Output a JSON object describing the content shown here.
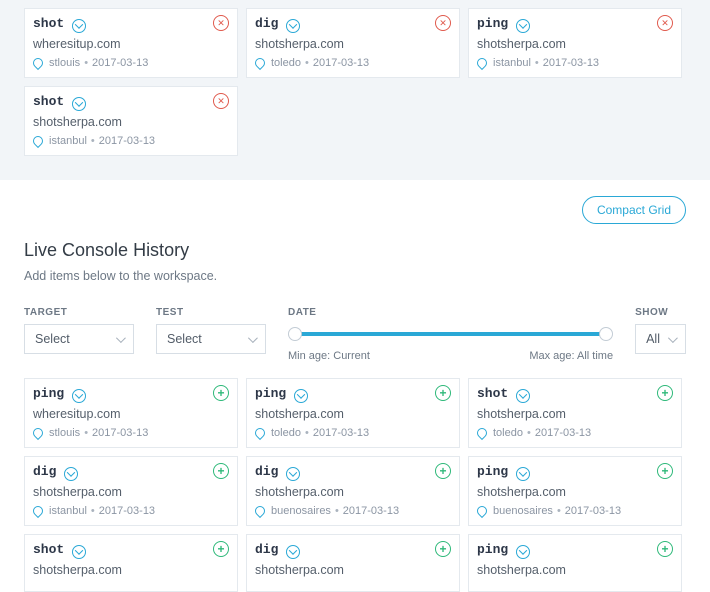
{
  "workspace": {
    "cards": [
      {
        "cmd": "shot",
        "domain": "wheresitup.com",
        "location": "stlouis",
        "date": "2017-03-13"
      },
      {
        "cmd": "dig",
        "domain": "shotsherpa.com",
        "location": "toledo",
        "date": "2017-03-13"
      },
      {
        "cmd": "ping",
        "domain": "shotsherpa.com",
        "location": "istanbul",
        "date": "2017-03-13"
      },
      {
        "cmd": "shot",
        "domain": "shotsherpa.com",
        "location": "istanbul",
        "date": "2017-03-13"
      }
    ]
  },
  "compact_grid_label": "Compact Grid",
  "history_section": {
    "title": "Live Console History",
    "subtitle": "Add items below to the workspace."
  },
  "filters": {
    "target": {
      "label": "TARGET",
      "value": "Select"
    },
    "test": {
      "label": "TEST",
      "value": "Select"
    },
    "date": {
      "label": "DATE",
      "min_label": "Min age: Current",
      "max_label": "Max age: All time"
    },
    "show": {
      "label": "SHOW",
      "value": "All"
    }
  },
  "history": {
    "cards": [
      {
        "cmd": "ping",
        "domain": "wheresitup.com",
        "location": "stlouis",
        "date": "2017-03-13"
      },
      {
        "cmd": "ping",
        "domain": "shotsherpa.com",
        "location": "toledo",
        "date": "2017-03-13"
      },
      {
        "cmd": "shot",
        "domain": "shotsherpa.com",
        "location": "toledo",
        "date": "2017-03-13"
      },
      {
        "cmd": "dig",
        "domain": "shotsherpa.com",
        "location": "istanbul",
        "date": "2017-03-13"
      },
      {
        "cmd": "dig",
        "domain": "shotsherpa.com",
        "location": "buenosaires",
        "date": "2017-03-13"
      },
      {
        "cmd": "ping",
        "domain": "shotsherpa.com",
        "location": "buenosaires",
        "date": "2017-03-13"
      },
      {
        "cmd": "shot",
        "domain": "shotsherpa.com",
        "location": "",
        "date": ""
      },
      {
        "cmd": "dig",
        "domain": "shotsherpa.com",
        "location": "",
        "date": ""
      },
      {
        "cmd": "ping",
        "domain": "shotsherpa.com",
        "location": "",
        "date": ""
      }
    ]
  }
}
